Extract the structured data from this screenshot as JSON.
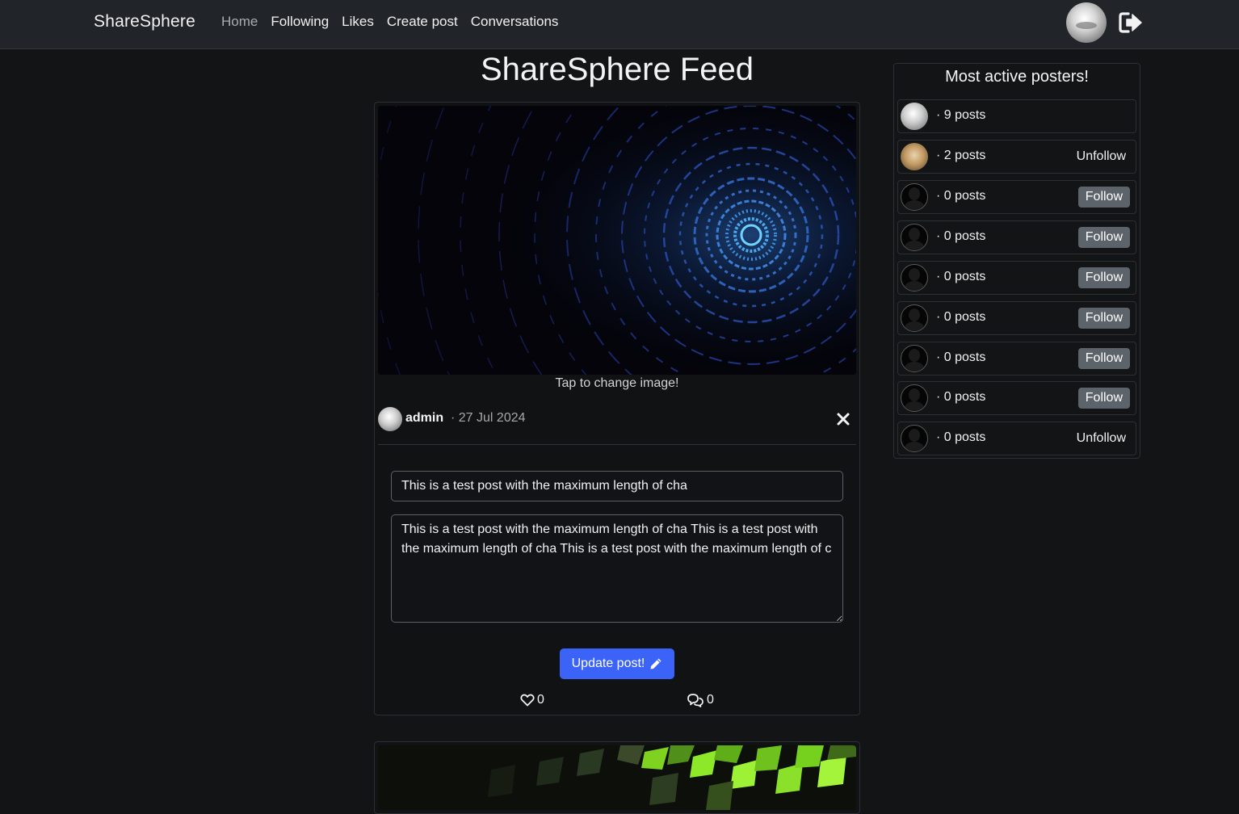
{
  "nav": {
    "brand": "ShareSphere",
    "links": [
      "Home",
      "Following",
      "Likes",
      "Create post",
      "Conversations"
    ],
    "active_link": "Home"
  },
  "feed": {
    "title": "ShareSphere Feed",
    "post": {
      "tap_hint": "Tap to change image!",
      "author": "admin",
      "date": "· 27 Jul 2024",
      "title_value": "This is a test post with the maximum length of cha",
      "body_value": "This is a test post with the maximum length of cha This is a test post with the maximum length of cha This is a test post with the maximum length of c",
      "update_label": "Update post!",
      "likes": "0",
      "comments": "0"
    }
  },
  "sidebar": {
    "title": "Most active posters!",
    "posters": [
      {
        "count": "· 9 posts",
        "avatar": "admin",
        "action": ""
      },
      {
        "count": "· 2 posts",
        "avatar": "cat",
        "action": "Unfollow"
      },
      {
        "count": "· 0 posts",
        "avatar": "default",
        "action": "Follow"
      },
      {
        "count": "· 0 posts",
        "avatar": "default",
        "action": "Follow"
      },
      {
        "count": "· 0 posts",
        "avatar": "default",
        "action": "Follow"
      },
      {
        "count": "· 0 posts",
        "avatar": "default",
        "action": "Follow"
      },
      {
        "count": "· 0 posts",
        "avatar": "default",
        "action": "Follow"
      },
      {
        "count": "· 0 posts",
        "avatar": "default",
        "action": "Follow"
      },
      {
        "count": "· 0 posts",
        "avatar": "default",
        "action": "Unfollow"
      }
    ]
  },
  "icons": {
    "logout": "logout-icon",
    "close": "close-icon",
    "pencil": "pencil-icon",
    "heart": "heart-icon",
    "comments": "comments-icon"
  },
  "colors": {
    "background": "#131416",
    "navbar": "#212529",
    "primary_button": "#3b63f7",
    "secondary_button": "#5c636a"
  }
}
